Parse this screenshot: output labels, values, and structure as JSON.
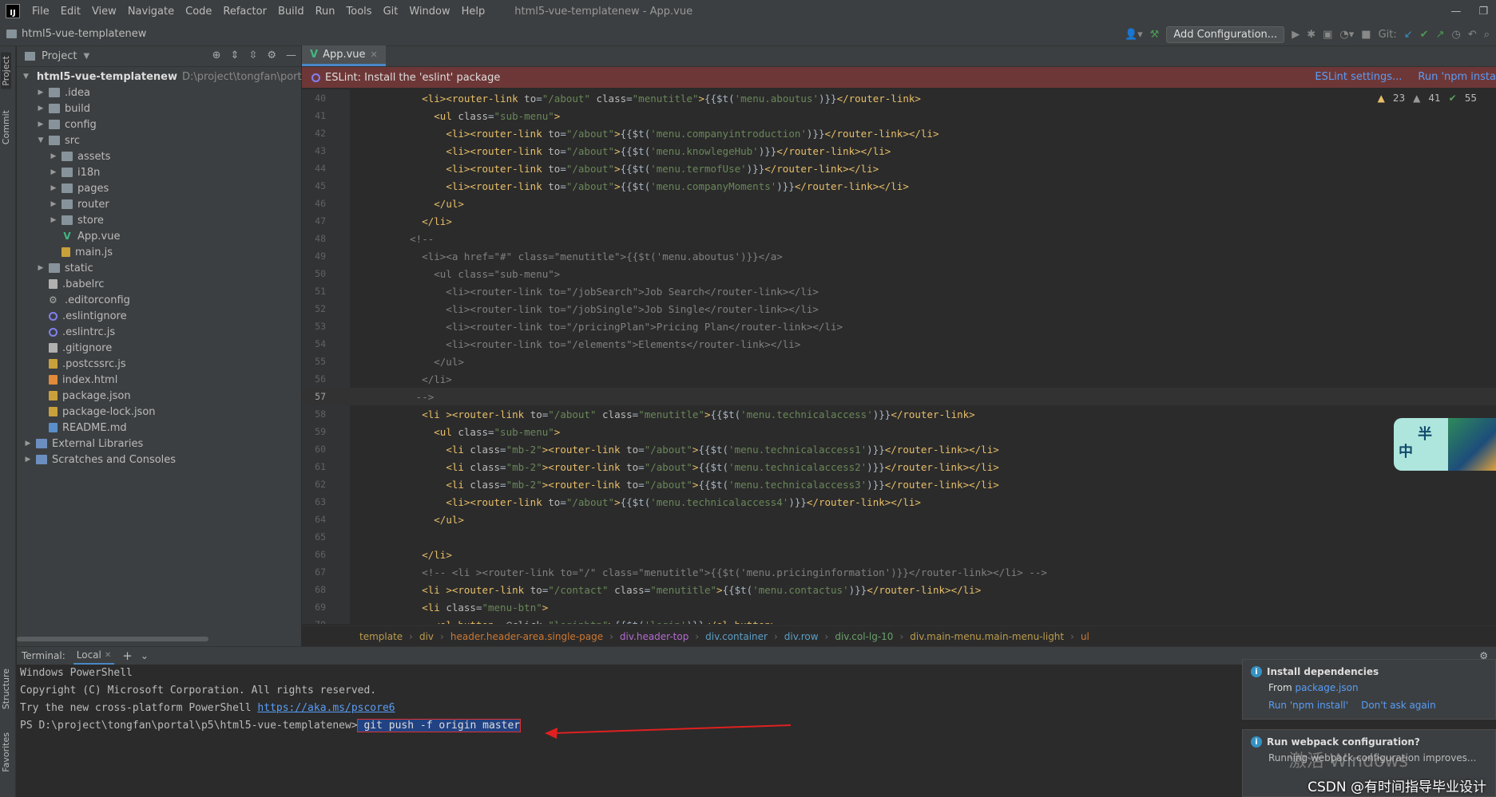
{
  "menu": {
    "logo": "IJ",
    "items": [
      "File",
      "Edit",
      "View",
      "Navigate",
      "Code",
      "Refactor",
      "Build",
      "Run",
      "Tools",
      "Git",
      "Window",
      "Help"
    ],
    "window_title": "html5-vue-templatenew - App.vue"
  },
  "navbar": {
    "project": "html5-vue-templatenew",
    "add_config": "Add Configuration...",
    "git_label": "Git:"
  },
  "sidebar_tabs": {
    "project": "Project",
    "commit": "Commit",
    "structure": "Structure",
    "favorites": "Favorites"
  },
  "project_panel": {
    "title": "Project",
    "tree": [
      {
        "label": "html5-vue-templatenew",
        "path": "D:\\project\\tongfan\\portal\\p",
        "depth": 0,
        "type": "folder",
        "expanded": true,
        "bold": true
      },
      {
        "label": ".idea",
        "depth": 1,
        "type": "folder",
        "expanded": false
      },
      {
        "label": "build",
        "depth": 1,
        "type": "folder",
        "expanded": false
      },
      {
        "label": "config",
        "depth": 1,
        "type": "folder",
        "expanded": false
      },
      {
        "label": "src",
        "depth": 1,
        "type": "folder",
        "expanded": true
      },
      {
        "label": "assets",
        "depth": 2,
        "type": "folder",
        "expanded": false
      },
      {
        "label": "i18n",
        "depth": 2,
        "type": "folder",
        "expanded": false
      },
      {
        "label": "pages",
        "depth": 2,
        "type": "folder",
        "expanded": false
      },
      {
        "label": "router",
        "depth": 2,
        "type": "folder",
        "expanded": false
      },
      {
        "label": "store",
        "depth": 2,
        "type": "folder",
        "expanded": false
      },
      {
        "label": "App.vue",
        "depth": 2,
        "type": "vue"
      },
      {
        "label": "main.js",
        "depth": 2,
        "type": "js"
      },
      {
        "label": "static",
        "depth": 1,
        "type": "folder",
        "expanded": false
      },
      {
        "label": ".babelrc",
        "depth": 1,
        "type": "file"
      },
      {
        "label": ".editorconfig",
        "depth": 1,
        "type": "gear"
      },
      {
        "label": ".eslintignore",
        "depth": 1,
        "type": "eslint"
      },
      {
        "label": ".eslintrc.js",
        "depth": 1,
        "type": "eslint"
      },
      {
        "label": ".gitignore",
        "depth": 1,
        "type": "file"
      },
      {
        "label": ".postcssrc.js",
        "depth": 1,
        "type": "js"
      },
      {
        "label": "index.html",
        "depth": 1,
        "type": "html"
      },
      {
        "label": "package.json",
        "depth": 1,
        "type": "json"
      },
      {
        "label": "package-lock.json",
        "depth": 1,
        "type": "json"
      },
      {
        "label": "README.md",
        "depth": 1,
        "type": "md"
      },
      {
        "label": "External Libraries",
        "depth": 0,
        "type": "lib",
        "expanded": false
      },
      {
        "label": "Scratches and Consoles",
        "depth": 0,
        "type": "lib",
        "expanded": false
      }
    ]
  },
  "editor": {
    "tab": "App.vue",
    "eslint_msg": "ESLint: Install the 'eslint' package",
    "eslint_links": [
      "ESLint settings...",
      "Run 'npm insta"
    ],
    "hints": {
      "warnings": "23",
      "weak": "41",
      "ok": "55"
    },
    "lines": [
      {
        "n": "40",
        "code": "        <li><router-link to=\"/about\" class=\"menutitle\">{{$t('menu.aboutus')}}</router-link>"
      },
      {
        "n": "41",
        "code": "          <ul class=\"sub-menu\">"
      },
      {
        "n": "42",
        "code": "            <li><router-link to=\"/about\">{{$t('menu.companyintroduction')}}</router-link></li>"
      },
      {
        "n": "43",
        "code": "            <li><router-link to=\"/about\">{{$t('menu.knowlegeHub')}}</router-link></li>"
      },
      {
        "n": "44",
        "code": "            <li><router-link to=\"/about\">{{$t('menu.termofUse')}}</router-link></li>"
      },
      {
        "n": "45",
        "code": "            <li><router-link to=\"/about\">{{$t('menu.companyMoments')}}</router-link></li>"
      },
      {
        "n": "46",
        "code": "          </ul>"
      },
      {
        "n": "47",
        "code": "        </li>"
      },
      {
        "n": "48",
        "code": "      <!--",
        "comment": true
      },
      {
        "n": "49",
        "code": "        <li><a href=\"#\" class=\"menutitle\">{{$t('menu.aboutus')}}</a>",
        "comment": true
      },
      {
        "n": "50",
        "code": "          <ul class=\"sub-menu\">",
        "comment": true
      },
      {
        "n": "51",
        "code": "            <li><router-link to=\"/jobSearch\">Job Search</router-link></li>",
        "comment": true
      },
      {
        "n": "52",
        "code": "            <li><router-link to=\"/jobSingle\">Job Single</router-link></li>",
        "comment": true
      },
      {
        "n": "53",
        "code": "            <li><router-link to=\"/pricingPlan\">Pricing Plan</router-link></li>",
        "comment": true
      },
      {
        "n": "54",
        "code": "            <li><router-link to=\"/elements\">Elements</router-link></li>",
        "comment": true
      },
      {
        "n": "55",
        "code": "          </ul>",
        "comment": true
      },
      {
        "n": "56",
        "code": "        </li>",
        "comment": true
      },
      {
        "n": "57",
        "code": "       -->",
        "comment": true,
        "current": true
      },
      {
        "n": "58",
        "code": "        <li ><router-link to=\"/about\" class=\"menutitle\">{{$t('menu.technicalaccess')}}</router-link>"
      },
      {
        "n": "59",
        "code": "          <ul class=\"sub-menu\">"
      },
      {
        "n": "60",
        "code": "            <li class=\"mb-2\"><router-link to=\"/about\">{{$t('menu.technicalaccess1')}}</router-link></li>"
      },
      {
        "n": "61",
        "code": "            <li class=\"mb-2\"><router-link to=\"/about\">{{$t('menu.technicalaccess2')}}</router-link></li>"
      },
      {
        "n": "62",
        "code": "            <li class=\"mb-2\"><router-link to=\"/about\">{{$t('menu.technicalaccess3')}}</router-link></li>"
      },
      {
        "n": "63",
        "code": "            <li><router-link to=\"/about\">{{$t('menu.technicalaccess4')}}</router-link></li>"
      },
      {
        "n": "64",
        "code": "          </ul>"
      },
      {
        "n": "65",
        "code": ""
      },
      {
        "n": "66",
        "code": "        </li>"
      },
      {
        "n": "67",
        "code": "        <!-- <li ><router-link to=\"/\" class=\"menutitle\">{{$t('menu.pricinginformation')}}</router-link></li> -->",
        "comment": true
      },
      {
        "n": "68",
        "code": "        <li ><router-link to=\"/contact\" class=\"menutitle\">{{$t('menu.contactus')}}</router-link></li>"
      },
      {
        "n": "69",
        "code": "        <li class=\"menu-btn\">"
      },
      {
        "n": "70",
        "code": "          <el-button  @click=\"loginbtn\">{{$t('login')}}</el-button>"
      }
    ],
    "breadcrumbs": [
      {
        "label": "template",
        "color": "y"
      },
      {
        "label": "div",
        "color": "y"
      },
      {
        "label": "header.header-area.single-page",
        "color": "r"
      },
      {
        "label": "div.header-top",
        "color": "p"
      },
      {
        "label": "div.container",
        "color": "b"
      },
      {
        "label": "div.row",
        "color": "b"
      },
      {
        "label": "div.col-lg-10",
        "color": "g"
      },
      {
        "label": "div.main-menu.main-menu-light",
        "color": "y"
      },
      {
        "label": "ul",
        "color": "r"
      }
    ],
    "deco_text": [
      "半",
      "中"
    ]
  },
  "terminal": {
    "label": "Terminal:",
    "tab": "Local",
    "lines": [
      "Windows PowerShell",
      "Copyright (C) Microsoft Corporation. All rights reserved."
    ],
    "try_text": "Try the new cross-platform PowerShell ",
    "try_link": "https://aka.ms/pscore6",
    "prompt": "PS D:\\project\\tongfan\\portal\\p5\\html5-vue-templatenew>",
    "command": " git push -f origin master"
  },
  "notifications": [
    {
      "title": "Install dependencies",
      "body_prefix": "From ",
      "body_link": "package.json",
      "actions": [
        "Run 'npm install'",
        "Don't ask again"
      ]
    },
    {
      "title": "Run webpack configuration?",
      "body": "Running webpack configuration improves..."
    }
  ],
  "overlay": {
    "activate": "激活 Windows",
    "watermark": "CSDN @有时间指导毕业设计"
  }
}
